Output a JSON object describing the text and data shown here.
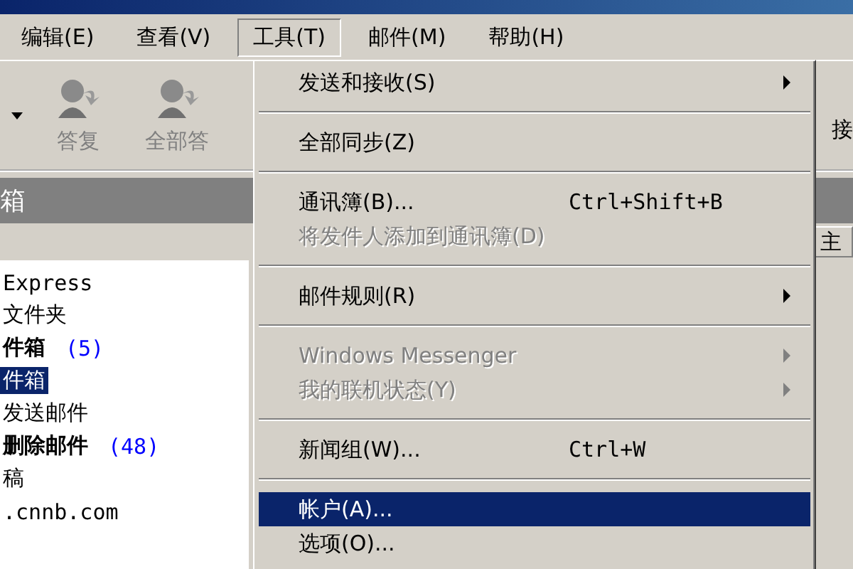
{
  "menubar": [
    {
      "label": "编辑(E)",
      "selected": false
    },
    {
      "label": "查看(V)",
      "selected": false
    },
    {
      "label": "工具(T)",
      "selected": true
    },
    {
      "label": "邮件(M)",
      "selected": false
    },
    {
      "label": "帮助(H)",
      "selected": false
    }
  ],
  "toolbar": {
    "buttons": [
      {
        "label": "答复"
      },
      {
        "label": "全部答"
      }
    ],
    "right_label": "接"
  },
  "folder_pane": {
    "title": "箱",
    "column_label": "主"
  },
  "folders": [
    {
      "name": "Express",
      "unread": false,
      "selected": false
    },
    {
      "name": "文件夹",
      "unread": false,
      "selected": false
    },
    {
      "name": "件箱",
      "count": "(5)",
      "unread": true,
      "selected": false
    },
    {
      "name": "件箱",
      "unread": false,
      "selected": true
    },
    {
      "name": "发送邮件",
      "unread": false,
      "selected": false
    },
    {
      "name": "删除邮件",
      "count": "(48)",
      "unread": true,
      "selected": false
    },
    {
      "name": "稿",
      "unread": false,
      "selected": false
    },
    {
      "name": ".cnnb.com",
      "unread": false,
      "selected": false
    }
  ],
  "menu": [
    {
      "kind": "item",
      "label": "发送和接收(S)",
      "submenu": true,
      "disabled": false,
      "selected": false
    },
    {
      "kind": "separator"
    },
    {
      "kind": "item",
      "label": "全部同步(Z)",
      "submenu": false,
      "disabled": false,
      "selected": false
    },
    {
      "kind": "separator"
    },
    {
      "kind": "item",
      "label": "通讯簿(B)...",
      "shortcut": "Ctrl+Shift+B",
      "submenu": false,
      "disabled": false,
      "selected": false
    },
    {
      "kind": "item",
      "label": "将发件人添加到通讯簿(D)",
      "submenu": false,
      "disabled": true,
      "selected": false
    },
    {
      "kind": "separator"
    },
    {
      "kind": "item",
      "label": "邮件规则(R)",
      "submenu": true,
      "disabled": false,
      "selected": false
    },
    {
      "kind": "separator"
    },
    {
      "kind": "item",
      "label": "Windows Messenger",
      "submenu": true,
      "disabled": true,
      "selected": false
    },
    {
      "kind": "item",
      "label": "我的联机状态(Y)",
      "submenu": true,
      "disabled": true,
      "selected": false
    },
    {
      "kind": "separator"
    },
    {
      "kind": "item",
      "label": "新闻组(W)...",
      "shortcut": "Ctrl+W",
      "submenu": false,
      "disabled": false,
      "selected": false
    },
    {
      "kind": "separator"
    },
    {
      "kind": "item",
      "label": "帐户(A)...",
      "submenu": false,
      "disabled": false,
      "selected": true
    },
    {
      "kind": "item",
      "label": "选项(O)...",
      "submenu": false,
      "disabled": false,
      "selected": false
    }
  ]
}
